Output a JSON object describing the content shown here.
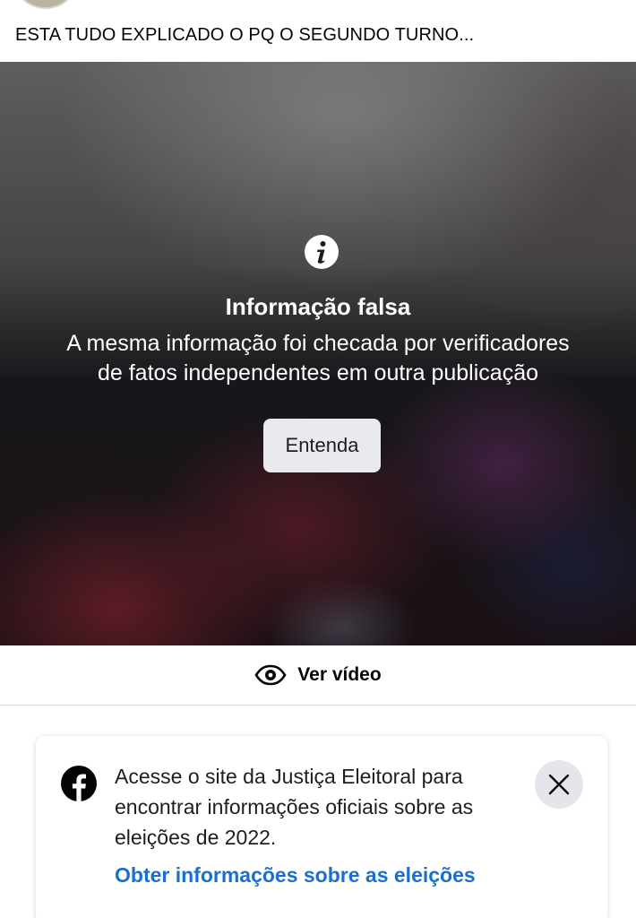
{
  "post": {
    "text": "ESTA TUDO EXPLICADO O PQ O SEGUNDO TURNO..."
  },
  "warning": {
    "icon": "info-icon",
    "title": "Informação falsa",
    "line1": "A mesma informação foi checada por verificadores",
    "line2": "de fatos independentes em outra publicação",
    "button_label": "Entenda"
  },
  "view_video": {
    "icon": "eye-icon",
    "label": "Ver vídeo"
  },
  "election_card": {
    "icon": "facebook-icon",
    "line1": "Acesse o site da Justiça Eleitoral para",
    "line2": "encontrar informações oficiais sobre as",
    "line3": "eleições de 2022.",
    "link_label": "Obter informações sobre as eleições",
    "close_icon": "close-icon"
  },
  "colors": {
    "link": "#1b6fcf",
    "button_bg": "#e9eaee",
    "close_bg": "#e4e6eb"
  }
}
